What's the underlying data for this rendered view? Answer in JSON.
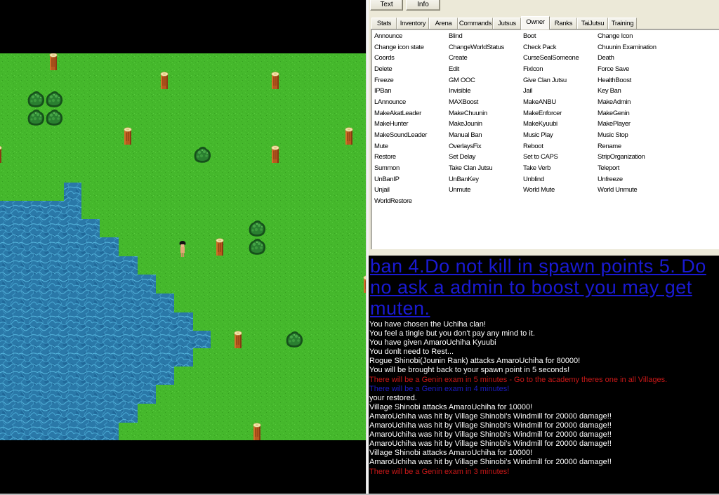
{
  "toolbar": {
    "buttons": [
      {
        "label": "Text"
      },
      {
        "label": "Info"
      }
    ]
  },
  "tabs": [
    {
      "label": "Stats"
    },
    {
      "label": "Inventory"
    },
    {
      "label": "Arena"
    },
    {
      "label": "Commands"
    },
    {
      "label": "Jutsus"
    },
    {
      "label": "Owner",
      "active": true
    },
    {
      "label": "Ranks"
    },
    {
      "label": "TaiJutsu"
    },
    {
      "label": "Training"
    }
  ],
  "commands": [
    "Announce",
    "Blind",
    "Boot",
    "Change Icon",
    "Change icon state",
    "ChangeWorldStatus",
    "Check Pack",
    "Chuunin Examination",
    "Coords",
    "Create",
    "CurseSealSomeone",
    "Death",
    "Delete",
    "Edit",
    "FixIcon",
    "Force Save",
    "Freeze",
    "GM OOC",
    "Give Clan Jutsu",
    "HealthBoost",
    "IPBan",
    "Invisible",
    "Jail",
    "Key Ban",
    "LAnnounce",
    "MAXBoost",
    "MakeANBU",
    "MakeAdmin",
    "MakeAkatLeader",
    "MakeChuunin",
    "MakeEnforcer",
    "MakeGenin",
    "MakeHunter",
    "MakeJounin",
    "MakeKyuubi",
    "MakePlayer",
    "MakeSoundLeader",
    "Manual Ban",
    "Music Play",
    "Music Stop",
    "Mute",
    "OverlaysFix",
    "Reboot",
    "Rename",
    "Restore",
    "Set Delay",
    "Set to CAPS",
    "StripOrganization",
    "Summon",
    "Take Clan Jutsu",
    "Take Verb",
    "Teleport",
    "UnBanIP",
    "UnBanKey",
    "Unblind",
    "Unfreeze",
    "Unjail",
    "Unmute",
    "World Mute",
    "World Unmute",
    "WorldRestore"
  ],
  "chat": {
    "announcement": {
      "color": "link_blue",
      "lines": [
        "ban 4.Do not kill in spawn points 5. Do",
        "no ask a admin to boost you may get",
        "muten."
      ]
    },
    "messages": [
      {
        "text": "You have chosen the Uchiha clan!",
        "color": "text_white"
      },
      {
        "text": "You feel a tingle but you don't pay any mind to it.",
        "color": "text_white"
      },
      {
        "text": "You have given AmaroUchiha Kyuubi",
        "color": "text_white"
      },
      {
        "text": "You donlt need to Rest...",
        "color": "text_white"
      },
      {
        "text": "Rogue Shinobi(Jounin Rank) attacks AmaroUchiha for 80000!",
        "color": "text_white"
      },
      {
        "text": "You will be brought back to your spawn point in 5 seconds!",
        "color": "text_white"
      },
      {
        "text": "There will be a Genin exam in 5 minutes - Go to the academy theres one in all Villages.",
        "color": "alert_red"
      },
      {
        "text": "There will be a Genin exam in 4 minutes!",
        "color": "notice_blue"
      },
      {
        "text": "your restored.",
        "color": "text_white"
      },
      {
        "text": "Village Shinobi attacks AmaroUchiha for 10000!",
        "color": "text_white"
      },
      {
        "text": "AmaroUchiha was hit by Village Shinobi's Windmill for 20000 damage!!",
        "color": "text_white"
      },
      {
        "text": "AmaroUchiha was hit by Village Shinobi's Windmill for 20000 damage!!",
        "color": "text_white"
      },
      {
        "text": "AmaroUchiha was hit by Village Shinobi's Windmill for 20000 damage!!",
        "color": "text_white"
      },
      {
        "text": "AmaroUchiha was hit by Village Shinobi's Windmill for 20000 damage!!",
        "color": "text_white"
      },
      {
        "text": "Village Shinobi attacks AmaroUchiha for 10000!",
        "color": "text_white"
      },
      {
        "text": "AmaroUchiha was hit by Village Shinobi's Windmill for 20000 damage!!",
        "color": "text_white"
      },
      {
        "text": "There will be a Genin exam in 3 minutes!",
        "color": "alert_red"
      }
    ]
  },
  "colors": {
    "text_white": "#ffffff",
    "alert_red": "#c81818",
    "notice_blue": "#1c1cc4",
    "link_blue": "#1a1ad4",
    "grass": "#45b82c",
    "water": "#2a78a8"
  },
  "map": {
    "terrain": [
      "grass",
      "water"
    ],
    "sprites": [
      "tree-stump",
      "bush",
      "player-character"
    ]
  }
}
